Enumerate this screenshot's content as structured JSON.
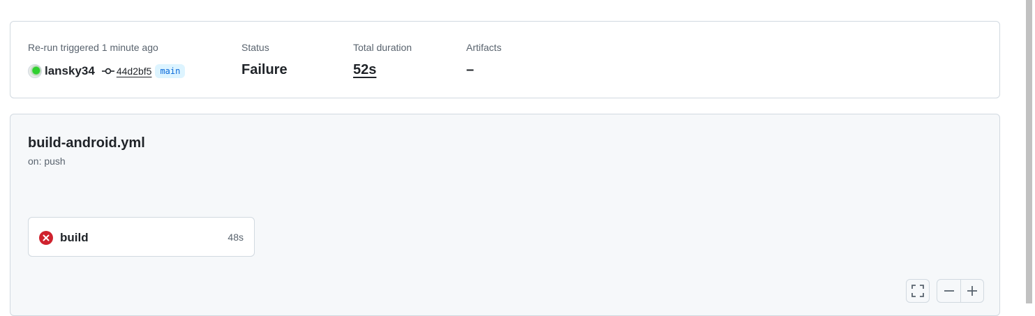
{
  "summary": {
    "trigger_label": "Re-run triggered 1 minute ago",
    "actor": "lansky34",
    "commit_sha": "44d2bf5",
    "branch": "main",
    "status_label": "Status",
    "status_value": "Failure",
    "duration_label": "Total duration",
    "duration_value": "52s",
    "artifacts_label": "Artifacts",
    "artifacts_value": "–"
  },
  "workflow": {
    "file": "build-android.yml",
    "trigger": "on: push"
  },
  "jobs": [
    {
      "name": "build",
      "duration": "48s",
      "status": "failure"
    }
  ],
  "graph_controls": {
    "fullscreen_icon": "fullscreen-icon",
    "zoom_out_icon": "minus-icon",
    "zoom_in_icon": "plus-icon"
  },
  "colors": {
    "failure": "#cf222e",
    "branch_bg": "#ddf4ff",
    "branch_fg": "#0969da",
    "panel_bg": "#f6f8fa",
    "border": "#d1d9e0"
  }
}
